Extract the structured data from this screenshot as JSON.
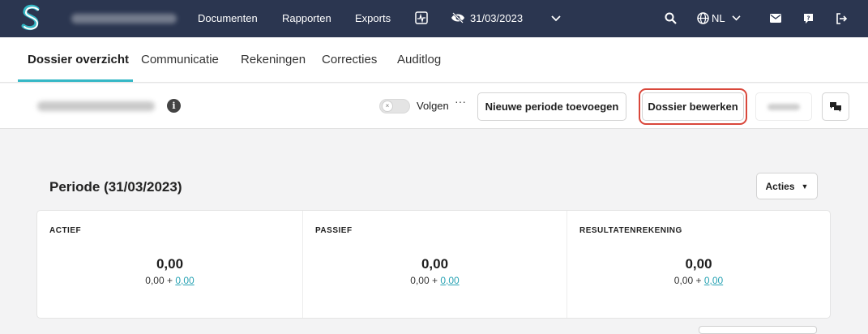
{
  "topbar": {
    "nav": [
      "Documenten",
      "Rapporten",
      "Exports"
    ],
    "date": "31/03/2023",
    "language": "NL",
    "colors": {
      "background": "#2b3650",
      "logo": "#35b8c6"
    }
  },
  "tabs": [
    "Dossier overzicht",
    "Communicatie",
    "Rekeningen",
    "Correcties",
    "Auditlog"
  ],
  "toolbar": {
    "follow_label": "Volgen",
    "more_label": "···",
    "toggle_off_label": "×",
    "new_period_label": "Nieuwe periode toevoegen",
    "edit_dossier_label": "Dossier bewerken"
  },
  "period": {
    "title": "Periode (31/03/2023)",
    "actions_label": "Acties"
  },
  "summary": [
    {
      "heading": "ACTIEF",
      "total": "0,00",
      "base": "0,00 + ",
      "link": "0,00"
    },
    {
      "heading": "PASSIEF",
      "total": "0,00",
      "base": "0,00 + ",
      "link": "0,00"
    },
    {
      "heading": "RESULTATENREKENING",
      "total": "0,00",
      "base": "0,00 + ",
      "link": "0,00"
    }
  ],
  "info_glyph": "i"
}
